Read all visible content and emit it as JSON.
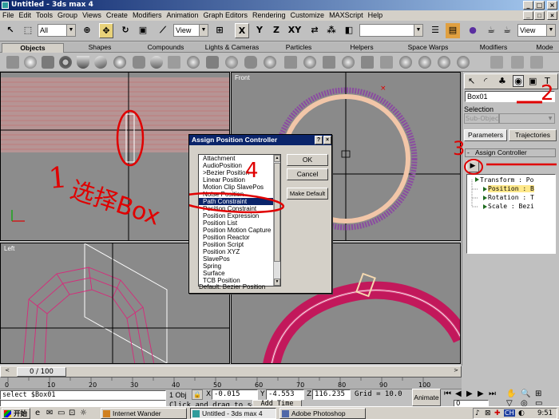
{
  "window": {
    "title": "Untitled - 3ds max 4"
  },
  "menu": [
    "File",
    "Edit",
    "Tools",
    "Group",
    "Views",
    "Create",
    "Modifiers",
    "Animation",
    "Graph Editors",
    "Rendering",
    "Customize",
    "MAXScript",
    "Help"
  ],
  "toolbar": {
    "selection_filter": "All",
    "ref_coord": "View",
    "axis_x": "X",
    "axis_y": "Y",
    "axis_z": "Z",
    "axis_xy": "XY",
    "render_view": "View"
  },
  "tabs": [
    "Objects",
    "Shapes",
    "Compounds",
    "Lights & Cameras",
    "Particles",
    "Helpers",
    "Space Warps",
    "Modifiers",
    "Mode"
  ],
  "viewports": {
    "top_left": "",
    "front": "Front",
    "left": "Left"
  },
  "command_panel": {
    "object_name": "Box01",
    "selection_label": "Selection",
    "sub_object": "Sub-Object",
    "tab_parameters": "Parameters",
    "tab_trajectories": "Trajectories",
    "rollout_title": "Assign Controller",
    "tree": [
      "Transform : Po",
      "Position : B",
      "Rotation : T",
      "Scale : Bezi"
    ]
  },
  "dialog": {
    "title": "Assign Position Controller",
    "help_btn": "?",
    "close_btn": "×",
    "items": [
      "Attachment",
      "AudioPosition",
      ">Bezier Position",
      "Linear Position",
      "Motion Clip SlavePos",
      "Noise Position",
      "Path Constraint",
      "Position Constraint",
      "Position Expression",
      "Position List",
      "Position Motion Capture",
      "Position Reactor",
      "Position Script",
      "Position XYZ",
      "SlavePos",
      "Spring",
      "Surface",
      "TCB Position"
    ],
    "selected_index": 6,
    "ok": "OK",
    "cancel": "Cancel",
    "make_default": "Make Default",
    "default_text": "Default:  Bezier Position"
  },
  "timeline": {
    "frame": "0 / 100",
    "ticks": [
      "0",
      "10",
      "20",
      "30",
      "40",
      "50",
      "60",
      "70",
      "80",
      "90",
      "100"
    ]
  },
  "status": {
    "maxscript": "select $Box01",
    "selection_count": "1 Obj",
    "x_label": "X",
    "x": "-0.015",
    "y_label": "Y",
    "y": "-4.553",
    "z_label": "Z",
    "z": "116.235",
    "grid": "Grid = 10.0",
    "prompt": "Click and drag to sel",
    "add_time_tag": "Add Time Tag",
    "animate": "Animate",
    "frame_field": "0"
  },
  "annotations": {
    "n1": "1",
    "n1_text": "选择Box",
    "n2": "2",
    "n3": "3",
    "n4": "4"
  },
  "taskbar": {
    "start": "开始",
    "tasks": [
      "Internet Wander",
      "Untitled - 3ds max 4",
      "Adobe Photoshop"
    ],
    "lang": "CH",
    "clock": "9:51"
  }
}
